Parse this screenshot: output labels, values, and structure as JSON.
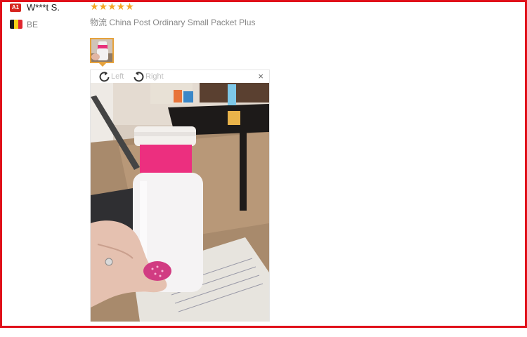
{
  "reviewer": {
    "badge": "A1",
    "name": "W***t S.",
    "country": "BE",
    "flag_colors": [
      "#1a1a1a",
      "#f7d117",
      "#e0262f"
    ]
  },
  "review": {
    "rating": 5,
    "stars": "★★★★★",
    "star_color": "#f5a623",
    "logistics_label": "物流",
    "shipping_method": "China Post Ordinary Small Packet Plus"
  },
  "viewer": {
    "rotate_left_label": "Left",
    "rotate_right_label": "Right",
    "close_label": "×",
    "rotate_left_icon": "rotate-left-icon",
    "rotate_right_icon": "rotate-right-icon",
    "close_icon": "close-icon"
  },
  "colors": {
    "frame_border": "#e0101a",
    "thumb_border": "#e6a23c"
  }
}
